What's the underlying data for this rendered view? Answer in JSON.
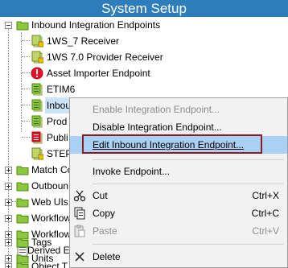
{
  "window": {
    "title": "System Setup"
  },
  "tree": {
    "root": {
      "label": "Inbound Integration Endpoints"
    },
    "children": [
      {
        "label": "1WS_7 Receiver",
        "icon": "endpoint-stopped-icon"
      },
      {
        "label": "1WS 7.0 Provider Receiver",
        "icon": "endpoint-stopped-icon"
      },
      {
        "label": "Asset Importer Endpoint",
        "icon": "endpoint-error-icon"
      },
      {
        "label": "ETIM6",
        "icon": "endpoint-running-icon"
      },
      {
        "label": "Inbound Data",
        "icon": "endpoint-running-icon",
        "selected": true
      },
      {
        "label": "Prod",
        "icon": "endpoint-running-icon"
      },
      {
        "label": "Publi",
        "icon": "endpoint-disabled-icon"
      },
      {
        "label": "STEP",
        "icon": "endpoint-stopped-icon"
      }
    ],
    "siblings": [
      {
        "label": "Match Co",
        "expander": "plus"
      },
      {
        "label": "Outboun",
        "expander": "plus"
      },
      {
        "label": "Web UIs",
        "expander": "plus"
      },
      {
        "label": "Workflow",
        "expander": "plus"
      },
      {
        "label": "Workflow",
        "expander": "plus"
      },
      {
        "label": "Derived E",
        "expander": "none"
      },
      {
        "label": "Object T",
        "expander": "plus"
      },
      {
        "label": "Tags",
        "expander": "plus"
      },
      {
        "label": "Units",
        "expander": "plus"
      }
    ]
  },
  "context_menu": {
    "items": [
      {
        "label": "Enable Integration Endpoint...",
        "disabled": true
      },
      {
        "label": "Disable Integration Endpoint...",
        "disabled": false
      },
      {
        "label": "Edit Inbound Integration Endpoint...",
        "disabled": false,
        "highlighted": true
      },
      {
        "label": "Invoke Endpoint...",
        "disabled": false
      },
      {
        "label": "Cut",
        "shortcut": "Ctrl+X",
        "icon": "scissors-icon",
        "disabled": false
      },
      {
        "label": "Copy",
        "shortcut": "Ctrl+C",
        "icon": "copy-icon",
        "disabled": false
      },
      {
        "label": "Paste",
        "shortcut": "Ctrl+V",
        "icon": "paste-icon",
        "disabled": true
      },
      {
        "label": "Delete",
        "icon": "delete-icon",
        "disabled": false
      }
    ]
  },
  "colors": {
    "titlebar": "#2d7dba",
    "selection": "#cce4f7",
    "menu_highlight": "#a9d0f5",
    "highlight_border": "#8e1b22",
    "folder": "#8dc63f",
    "error": "#e81123"
  }
}
